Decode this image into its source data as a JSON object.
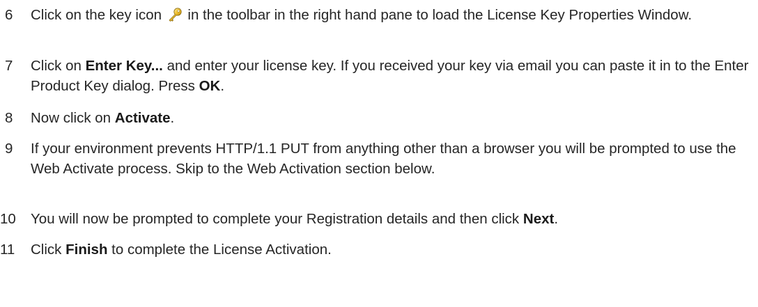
{
  "steps": [
    {
      "number": "6",
      "parts": [
        {
          "text": "Click on the key icon "
        },
        {
          "icon": "key-icon"
        },
        {
          "text": " in the toolbar in the right hand pane to load the License Key Properties Window."
        }
      ]
    },
    {
      "number": "7",
      "parts": [
        {
          "text": "Click on "
        },
        {
          "text": "Enter Key...",
          "bold": true
        },
        {
          "text": " and enter your license key. If you received your key via email you can paste it in to the Enter Product Key dialog. Press "
        },
        {
          "text": "OK",
          "bold": true
        },
        {
          "text": "."
        }
      ]
    },
    {
      "number": "8",
      "parts": [
        {
          "text": "Now click on "
        },
        {
          "text": "Activate",
          "bold": true
        },
        {
          "text": "."
        }
      ]
    },
    {
      "number": "9",
      "parts": [
        {
          "text": "If your environment prevents HTTP/1.1 PUT from anything other than a browser you will be prompted to use the Web Activate process. Skip to the Web Activation section below."
        }
      ]
    },
    {
      "number": "10",
      "parts": [
        {
          "text": "You will now be prompted to complete your Registration details and then click "
        },
        {
          "text": "Next",
          "bold": true
        },
        {
          "text": "."
        }
      ]
    },
    {
      "number": "11",
      "parts": [
        {
          "text": "Click "
        },
        {
          "text": "Finish",
          "bold": true
        },
        {
          "text": " to complete the License Activation."
        }
      ]
    }
  ]
}
